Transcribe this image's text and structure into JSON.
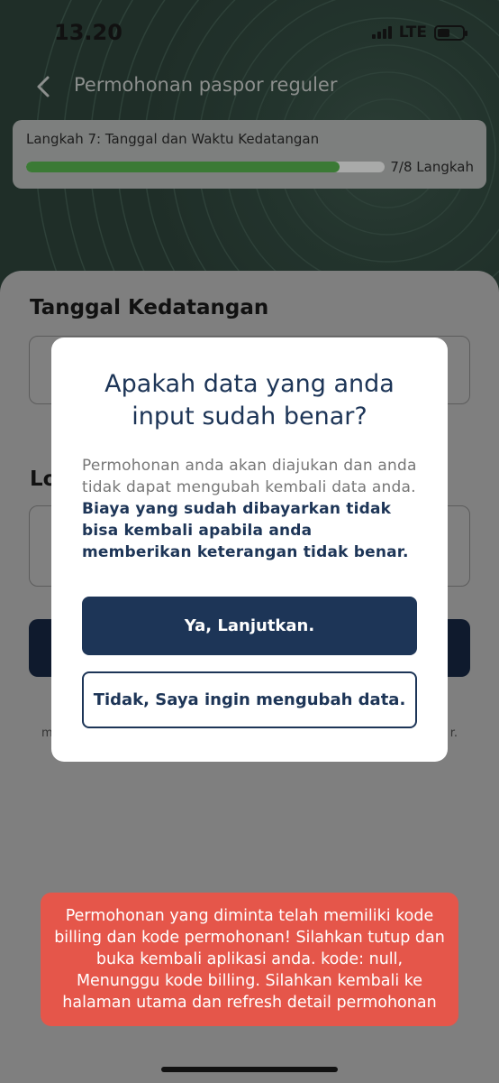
{
  "status_bar": {
    "time": "13.20",
    "network": "LTE",
    "icons": [
      "signal-icon",
      "battery-icon"
    ]
  },
  "nav": {
    "title": "Permohonan paspor reguler",
    "back_icon": "chevron-left-icon"
  },
  "progress": {
    "label": "Langkah 7: Tanggal dan Waktu Kedatangan",
    "count": "7/8 Langkah",
    "fraction": 0.875,
    "color": "#3b7a35"
  },
  "form": {
    "date_section_title": "Tanggal Kedatangan",
    "location_section_title_partial": "Lo",
    "fine_print_start": "m",
    "fine_print_end": "r."
  },
  "modal": {
    "title": "Apakah data yang anda input sudah benar?",
    "body_regular": "Permohonan anda akan diajukan dan anda tidak dapat mengubah kembali data anda.",
    "body_bold": "Biaya yang sudah dibayarkan tidak bisa kembali apabila anda memberikan keterangan tidak benar.",
    "confirm_label": "Ya, Lanjutkan.",
    "cancel_label": "Tidak, Saya ingin mengubah data."
  },
  "toast": {
    "message": "Permohonan yang diminta telah memiliki kode billing dan kode permohonan! Silahkan tutup dan buka kembali aplikasi anda. kode: null, Menunggu kode billing. Silahkan kembali ke halaman utama dan refresh detail permohonan",
    "color": "#e5564a"
  },
  "colors": {
    "primary": "#1d3557",
    "header_bg": "#1f2e28"
  }
}
